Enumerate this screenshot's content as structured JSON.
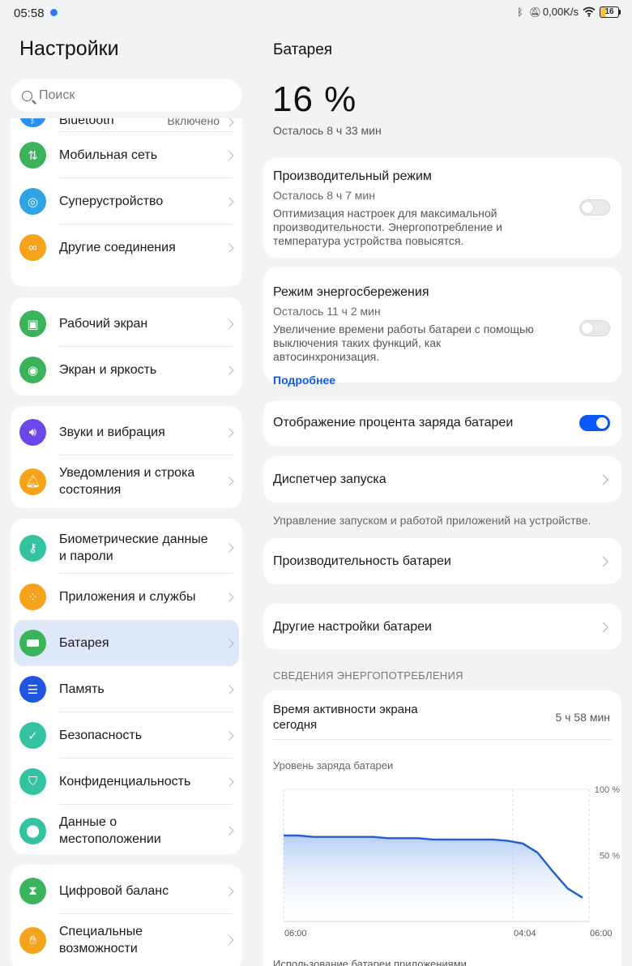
{
  "status": {
    "time": "05:58",
    "speed": "0,00K/s",
    "battery": "16"
  },
  "left": {
    "title": "Настройки",
    "search_placeholder": "Поиск",
    "groups": [
      {
        "items": [
          {
            "label": "Bluetooth",
            "value": "Включено",
            "icon": "bluetooth-icon",
            "color": "#2d8ff0"
          },
          {
            "label": "Мобильная сеть",
            "icon": "mobile-data-icon",
            "color": "#3ab35a"
          },
          {
            "label": "Суперустройство",
            "icon": "super-device-icon",
            "color": "#2fa3e6"
          },
          {
            "label": "Другие соединения",
            "icon": "link-icon",
            "color": "#f5a21c"
          }
        ]
      },
      {
        "items": [
          {
            "label": "Рабочий экран",
            "icon": "home-screen-icon",
            "color": "#3ab35a"
          },
          {
            "label": "Экран и яркость",
            "icon": "eye-icon",
            "color": "#3ab35a"
          }
        ]
      },
      {
        "items": [
          {
            "label": "Звуки и вибрация",
            "icon": "sound-icon",
            "color": "#6c46e8"
          },
          {
            "label": "Уведомления и строка состояния",
            "icon": "bell-icon",
            "color": "#f5a21c"
          }
        ]
      },
      {
        "items": [
          {
            "label": "Биометрические данные и пароли",
            "icon": "key-icon",
            "color": "#33c3a0"
          },
          {
            "label": "Приложения и службы",
            "icon": "apps-icon",
            "color": "#f5a21c"
          },
          {
            "label": "Батарея",
            "icon": "battery-icon",
            "color": "#3ab35a"
          },
          {
            "label": "Память",
            "icon": "storage-icon",
            "color": "#2055e0"
          },
          {
            "label": "Безопасность",
            "icon": "shield-icon",
            "color": "#33c3a0"
          },
          {
            "label": "Конфиденциальность",
            "icon": "privacy-icon",
            "color": "#33c3a0"
          },
          {
            "label": "Данные о местоположении",
            "icon": "location-icon",
            "color": "#33c3a0"
          }
        ]
      },
      {
        "items": [
          {
            "label": "Цифровой баланс",
            "icon": "hourglass-icon",
            "color": "#3ab35a"
          },
          {
            "label": "Специальные возможности",
            "icon": "accessibility-icon",
            "color": "#f5a21c"
          }
        ]
      }
    ]
  },
  "right": {
    "title": "Батарея",
    "percent": "16 %",
    "remaining": "Осталось 8 ч 33 мин",
    "performance": {
      "title": "Производительный режим",
      "sub": "Осталось 8 ч 7 мин",
      "desc": "Оптимизация настроек для максимальной производительности. Энергопотребление и температура устройства повысятся."
    },
    "saver": {
      "title": "Режим энергосбережения",
      "sub": "Осталось 11 ч 2 мин",
      "desc": "Увеличение времени работы батареи с помощью выключения таких функций, как автосинхронизация.",
      "link": "Подробнее"
    },
    "show_percent": "Отображение процента заряда батареи",
    "launch": "Диспетчер запуска",
    "launch_note": "Управление запуском и работой приложений на устройстве.",
    "battery_perf": "Производительность батареи",
    "more": "Другие настройки батареи",
    "section": "СВЕДЕНИЯ ЭНЕРГОПОТРЕБЛЕНИЯ",
    "screen_time_label": "Время активности экрана сегодня",
    "screen_time_value": "5 ч 58 мин",
    "chart_title": "Уровень заряда батареи",
    "cut_text": "Использование батареи приложениями"
  },
  "chart_data": {
    "type": "area",
    "title": "Уровень заряда батареи",
    "x_ticks": [
      "06:00",
      "04:04",
      "06:00"
    ],
    "y_ticks": [
      "100 %",
      "50 %"
    ],
    "ylim": [
      0,
      100
    ],
    "series": [
      {
        "values": [
          65,
          65,
          64,
          64,
          64,
          64,
          64,
          63,
          63,
          63,
          62,
          62,
          62,
          62,
          62,
          61,
          59,
          52,
          38,
          25,
          18
        ]
      }
    ],
    "color": "#1f5fd6"
  }
}
